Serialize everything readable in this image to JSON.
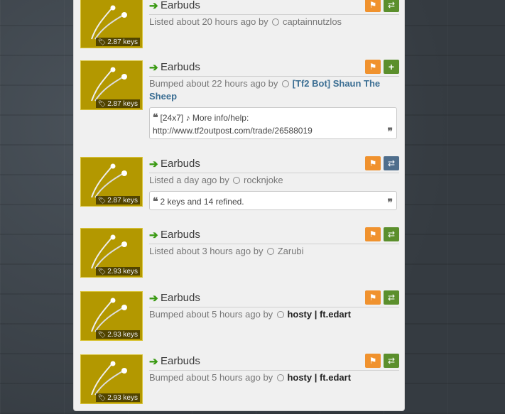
{
  "listings": [
    {
      "price": "2.87 keys",
      "title": "Earbuds",
      "meta_prefix": "Listed about 20 hours ago by",
      "user": "captainnutzlos",
      "user_style": "plain",
      "action": "swap",
      "message": ""
    },
    {
      "price": "2.87 keys",
      "title": "Earbuds",
      "meta_prefix": "Bumped about 22 hours ago by",
      "user": "[Tf2 Bot] Shaun The Sheep",
      "user_style": "bot",
      "action": "add",
      "message": "[24x7] ♪ More info/help: http://www.tf2outpost.com/trade/26588019"
    },
    {
      "price": "2.87 keys",
      "title": "Earbuds",
      "meta_prefix": "Listed a day ago by",
      "user": "rocknjoke",
      "user_style": "plain",
      "action": "swap-blue",
      "message": "2 keys and 14 refined."
    },
    {
      "price": "2.93 keys",
      "title": "Earbuds",
      "meta_prefix": "Listed about 3 hours ago by",
      "user": "Zarubi",
      "user_style": "plain",
      "action": "swap",
      "message": ""
    },
    {
      "price": "2.93 keys",
      "title": "Earbuds",
      "meta_prefix": "Bumped about 5 hours ago by",
      "user": "hosty | ft.edart",
      "user_style": "bold",
      "action": "swap",
      "message": ""
    },
    {
      "price": "2.93 keys",
      "title": "Earbuds",
      "meta_prefix": "Bumped about 5 hours ago by",
      "user": "hosty | ft.edart",
      "user_style": "bold",
      "action": "swap",
      "message": ""
    }
  ],
  "icons": {
    "arrow": "arrow-right-icon",
    "flag": "flag-icon",
    "swap": "swap-icon",
    "add": "plus-icon",
    "tag": "tag-icon",
    "quote": "quote-icon"
  },
  "colors": {
    "thumb_bg": "#b39800",
    "flag_btn": "#f0922e",
    "green_btn": "#5b8f2c",
    "blue_btn": "#4f6e8c",
    "bot_user": "#3b6e93",
    "arrow": "#3a9a12"
  }
}
